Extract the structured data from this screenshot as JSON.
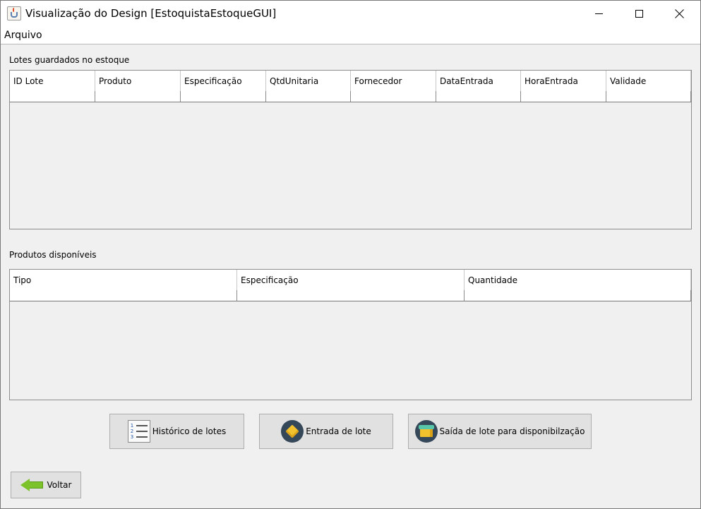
{
  "window": {
    "title": "Visualização do Design [EstoquistaEstoqueGUI]"
  },
  "menu": {
    "items": [
      "Arquivo"
    ]
  },
  "lotes": {
    "label": "Lotes guardados no estoque",
    "columns": [
      "ID Lote",
      "Produto",
      "Especificação",
      "QtdUnitaria",
      "Fornecedor",
      "DataEntrada",
      "HoraEntrada",
      "Validade"
    ]
  },
  "produtos": {
    "label": "Produtos disponíveis",
    "columns": [
      "Tipo",
      "Especificação",
      "Quantidade"
    ]
  },
  "actions": {
    "historico_label": "Histórico de lotes",
    "entrada_label": "Entrada de lote",
    "saida_label": "Saída de lote para disponibilzação",
    "voltar_label": "Voltar"
  },
  "icons": {
    "historico": "numbered-list-icon",
    "entrada": "box-icon",
    "saida": "open-box-icon",
    "voltar": "left-arrow-icon"
  }
}
